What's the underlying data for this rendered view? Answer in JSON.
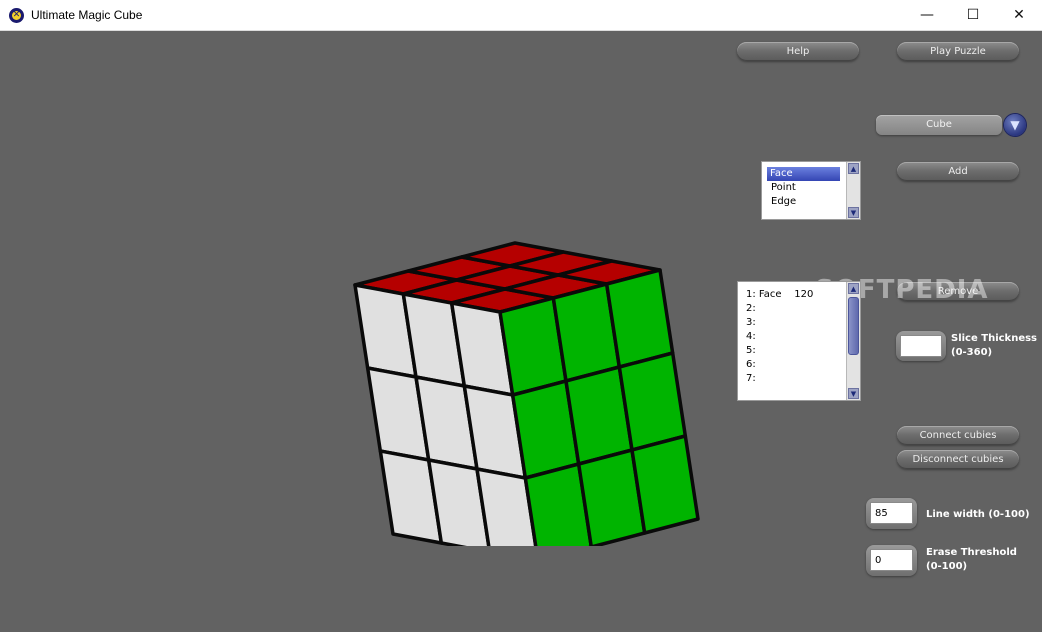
{
  "window": {
    "title": "Ultimate Magic Cube",
    "minimize": "—",
    "maximize": "☐",
    "close": "✕"
  },
  "toolbar": {
    "help_label": "Help",
    "play_label": "Play Puzzle"
  },
  "shape_select": {
    "selected": "Cube",
    "arrow": "▼"
  },
  "type_list": {
    "items": [
      "Face",
      "Point",
      "Edge"
    ],
    "selected_index": 0
  },
  "add_label": "Add",
  "remove_label": "Remove",
  "slice_list": {
    "rows": [
      "1: Face    120",
      "2:",
      "3:",
      "4:",
      "5:",
      "6:",
      "7:"
    ]
  },
  "slice_thickness": {
    "label_line1": "Slice Thickness",
    "label_line2": "(0-360)",
    "value": ""
  },
  "connect_label": "Connect cubies",
  "disconnect_label": "Disconnect cubies",
  "line_width": {
    "label": "Line width (0-100)",
    "value": "85"
  },
  "erase_threshold": {
    "label_line1": "Erase Threshold",
    "label_line2": "(0-100)",
    "value": "0"
  },
  "watermark": "SOFTPEDIA",
  "colors": {
    "top": "#b50000",
    "front": "#e0e0e0",
    "right": "#00b400",
    "lines": "#0a0a0a"
  }
}
